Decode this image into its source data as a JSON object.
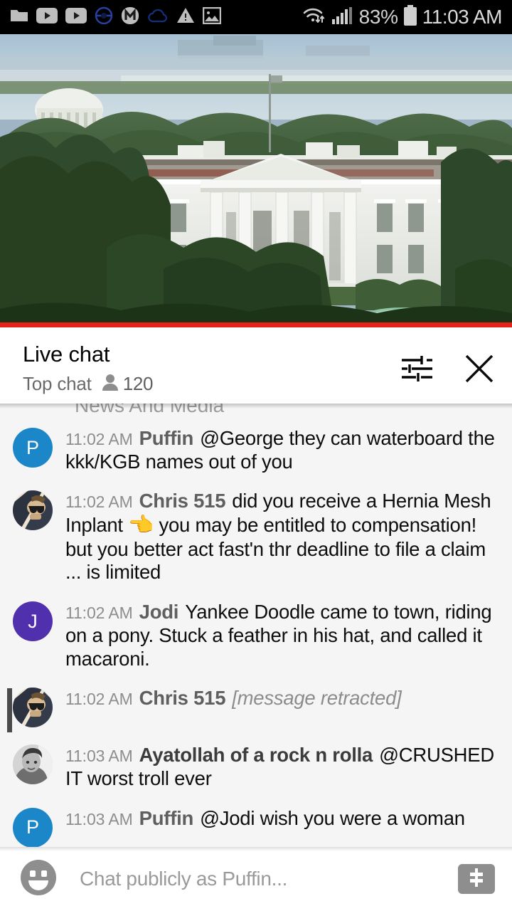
{
  "statusbar": {
    "icons": [
      "folder-icon",
      "video-play-icon",
      "video-play-icon",
      "pokeball-icon",
      "m-badge-icon",
      "cloud-icon",
      "warning-icon",
      "image-icon"
    ],
    "wifi_icon": "wifi-transfer-icon",
    "signal_icon": "cellular-signal-icon",
    "battery_percent": "83%",
    "battery_icon": "battery-full-icon",
    "time": "11:03 AM"
  },
  "video": {
    "name": "white-house-live-stream",
    "progress_color": "#e62117",
    "progress_percent": 100
  },
  "chat_header": {
    "title": "Live chat",
    "mode": "Top chat",
    "viewer_count": "120",
    "viewer_icon": "person-icon",
    "settings_icon": "tune-sliders-icon",
    "close_icon": "close-x-icon"
  },
  "clipped_message": "News And Media",
  "messages": [
    {
      "timestamp": "11:02 AM",
      "author": "Puffin",
      "text": "@George they can waterboard the kkk/KGB names out of you",
      "avatar": {
        "type": "initial",
        "letter": "P",
        "color": "#1b87c9"
      },
      "retracted": false
    },
    {
      "timestamp": "11:02 AM",
      "author": "Chris 515",
      "text_before_emoji": "did you receive a Hernia Mesh Inplant ",
      "emoji": "👈",
      "text_after_emoji": " you may be entitled to compensation! but you better act fast'n thr deadline to file a claim ... is limited",
      "avatar": {
        "type": "photo",
        "variant": "man-sunglasses-photo"
      },
      "retracted": false
    },
    {
      "timestamp": "11:02 AM",
      "author": "Jodi",
      "text": "Yankee Doodle came to town, riding on a pony. Stuck a feather in his hat, and called it macaroni.",
      "avatar": {
        "type": "initial",
        "letter": "J",
        "color": "#5130ad"
      },
      "retracted": false
    },
    {
      "timestamp": "11:02 AM",
      "author": "Chris 515",
      "text": "[message retracted]",
      "avatar": {
        "type": "photo",
        "variant": "man-sunglasses-photo"
      },
      "retracted": true
    },
    {
      "timestamp": "11:03 AM",
      "author": "Ayatollah of a rock n rolla",
      "text": "@CRUSHED IT worst troll ever",
      "avatar": {
        "type": "photo",
        "variant": "grayscale-portrait-photo"
      },
      "retracted": false
    },
    {
      "timestamp": "11:03 AM",
      "author": "Puffin",
      "text": "@Jodi wish you were a woman",
      "avatar": {
        "type": "initial",
        "letter": "P",
        "color": "#1b87c9"
      },
      "retracted": false
    }
  ],
  "input_bar": {
    "emoji_icon": "emoji-smiley-icon",
    "placeholder": "Chat publicly as Puffin...",
    "value": "",
    "superchat_icon": "dollar-sign-icon"
  }
}
